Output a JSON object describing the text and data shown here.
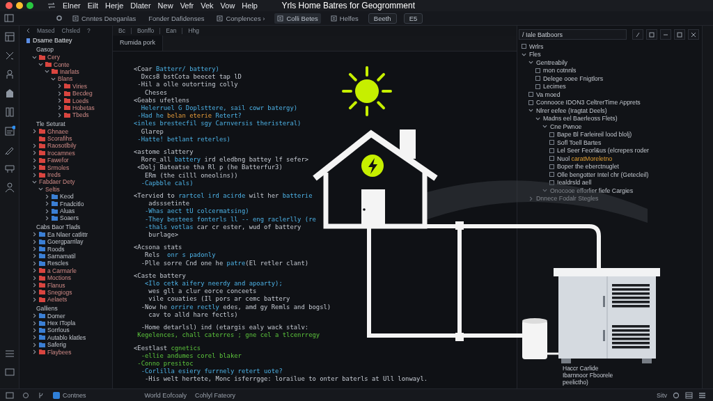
{
  "window": {
    "title": "Yrls Home Batres for Geogromment"
  },
  "menu": [
    "Elner",
    "Eilt",
    "Herje",
    "Dlater",
    "New",
    "Vefr",
    "Vek",
    "Vow",
    "Help"
  ],
  "toolbar": [
    {
      "label": "Cnntes Deeganlas",
      "kind": "icon",
      "selected": false
    },
    {
      "label": "Fonder Dafidenses",
      "kind": "text",
      "selected": false
    },
    {
      "label": "Conplences ›",
      "kind": "icon",
      "selected": false
    },
    {
      "label": "Colli Betes",
      "kind": "icon",
      "selected": true
    },
    {
      "label": "Helfes",
      "kind": "icon",
      "selected": false
    },
    {
      "label": "Beeth",
      "kind": "button",
      "selected": false
    },
    {
      "label": "E5",
      "kind": "button",
      "selected": false
    }
  ],
  "sidebar": {
    "toolbar": [
      "Mased",
      "Chsled",
      "?"
    ],
    "title": "Dsame Battey",
    "sections": [
      {
        "title": "Gasop",
        "items": [
          {
            "label": "Cery",
            "color": "#d9453f",
            "expanded": true,
            "children": [
              {
                "label": "Conte",
                "color": "#d9453f",
                "expanded": true,
                "children": [
                  {
                    "label": "Inarlats",
                    "color": "#d9453f",
                    "expanded": true,
                    "children": [
                      {
                        "label": "Blans",
                        "expanded": true,
                        "children": [
                          {
                            "label": "Viries",
                            "color": "#d9453f",
                            "expanded": false
                          },
                          {
                            "label": "Becdeg",
                            "color": "#d9453f",
                            "expanded": false
                          },
                          {
                            "label": "Loeds",
                            "color": "#d9453f",
                            "expanded": false
                          },
                          {
                            "label": "Hobetas",
                            "color": "#d9453f",
                            "expanded": false
                          },
                          {
                            "label": "Tbeds",
                            "color": "#d9453f",
                            "expanded": false
                          }
                        ]
                      }
                    ]
                  }
                ]
              }
            ]
          }
        ]
      },
      {
        "title": "Tle Seturat",
        "items": [
          {
            "label": "Ghnaee",
            "color": "#d9453f",
            "expanded": false
          },
          {
            "label": "Scorafihs",
            "color": "#d9453f"
          },
          {
            "label": "Raosotlbily",
            "color": "#d9453f",
            "expanded": false
          },
          {
            "label": "Irocamnes",
            "color": "#d9453f",
            "expanded": false
          },
          {
            "label": "Fawefor",
            "color": "#d9453f",
            "expanded": false
          },
          {
            "label": "Srmoles",
            "color": "#d9453f",
            "expanded": false
          },
          {
            "label": "Ireds",
            "color": "#d9453f",
            "expanded": false
          },
          {
            "label": "Fabdaer Dety",
            "expanded": true,
            "children": [
              {
                "label": "Seltis",
                "expanded": true,
                "children": [
                  {
                    "label": "Keod",
                    "color": "#3b7fd4",
                    "expanded": false
                  },
                  {
                    "label": "Fnadcitlo",
                    "color": "#3b7fd4",
                    "expanded": false
                  },
                  {
                    "label": "Aluas",
                    "color": "#3b7fd4",
                    "expanded": false
                  },
                  {
                    "label": "Soaers",
                    "color": "#3b7fd4",
                    "expanded": false
                  }
                ]
              }
            ]
          }
        ]
      },
      {
        "title": "Cabs Baor Tlads",
        "items": [
          {
            "label": "Ea Nlaer catlittr",
            "color": "#3b7fd4",
            "expanded": false
          },
          {
            "label": "Goergparrilay",
            "color": "#3b7fd4",
            "expanded": false
          },
          {
            "label": "Roods",
            "color": "#3b7fd4",
            "expanded": false
          },
          {
            "label": "Sarnamatil",
            "color": "#3b7fd4",
            "expanded": false
          },
          {
            "label": "Rescles",
            "color": "#3b7fd4",
            "expanded": false
          },
          {
            "label": "a Carmarle",
            "color": "#d9453f",
            "expanded": false
          },
          {
            "label": "Moctions",
            "color": "#d9453f",
            "expanded": false
          },
          {
            "label": "Flanus",
            "color": "#d9453f",
            "expanded": false
          },
          {
            "label": "Snegiogs",
            "color": "#d9453f",
            "expanded": false
          },
          {
            "label": "Aelaets",
            "color": "#d9453f",
            "expanded": false
          }
        ]
      },
      {
        "title": "Galliens",
        "items": [
          {
            "label": "Domer",
            "color": "#3b7fd4",
            "expanded": false
          },
          {
            "label": "Hex ITopla",
            "color": "#3b7fd4",
            "expanded": false
          },
          {
            "label": "Sorrlous",
            "color": "#3b7fd4",
            "expanded": false
          },
          {
            "label": "Autablo klatles",
            "color": "#3b7fd4",
            "expanded": false
          },
          {
            "label": "Saferig",
            "color": "#3b7fd4",
            "expanded": false
          },
          {
            "label": "Flaybees",
            "color": "#d9453f",
            "expanded": false
          }
        ]
      }
    ]
  },
  "editor": {
    "toolbar": [
      "Bc",
      "Bonffo",
      "Ean",
      "Hhg"
    ],
    "tab": "Rumida pork",
    "blocks": [
      {
        "lines": [
          [
            {
              "text": "<Coar ",
              "kind": "plain"
            },
            {
              "text": "Batterr/ battery)",
              "kind": "name"
            }
          ],
          [
            {
              "text": "  Dxcs8 bstCota beecet tap lD",
              "kind": "plain"
            }
          ],
          [
            {
              "text": " -Hil a olle outorting colly",
              "kind": "plain"
            }
          ],
          [
            {
              "text": "   Cheses",
              "kind": "plain"
            }
          ],
          [
            {
              "text": "<Geabs ufetlens",
              "kind": "plain"
            }
          ],
          [
            {
              "text": "  Helerruel G Doplsttere, sail cowr batergy)",
              "kind": "name"
            }
          ],
          [
            {
              "text": " -Had he ",
              "kind": "name"
            },
            {
              "text": "belan eterie",
              "kind": "warn"
            },
            {
              "text": " Retert?",
              "kind": "name"
            }
          ],
          [
            {
              "text": "<inles brestecfil sgy Carnversis theristeral)",
              "kind": "name"
            }
          ],
          [
            {
              "text": "  Glarep",
              "kind": "plain"
            }
          ],
          [
            {
              "text": " -Hatte! betlant reterles)",
              "kind": "name"
            }
          ]
        ]
      },
      {
        "lines": [
          [
            {
              "text": "<astome slattery",
              "kind": "plain"
            }
          ],
          [
            {
              "text": "  Rore_all ",
              "kind": "plain"
            },
            {
              "text": "battery",
              "kind": "name"
            },
            {
              "text": " ird eledbng battey lf sefer>",
              "kind": "plain"
            }
          ],
          [
            {
              "text": " <Dolj Bateatse tha Rl p (he Batterfur3)",
              "kind": "plain"
            }
          ],
          [
            {
              "text": "   ERm (the cilll oneolins))",
              "kind": "plain"
            }
          ],
          [
            {
              "text": "  -Capbble cals)",
              "kind": "name"
            }
          ]
        ]
      },
      {
        "lines": [
          [
            {
              "text": "<Tervied to ",
              "kind": "plain"
            },
            {
              "text": "rartcel ird acirde",
              "kind": "name"
            },
            {
              "text": " wilt her ",
              "kind": "plain"
            },
            {
              "text": "batterie",
              "kind": "name"
            }
          ],
          [
            {
              "text": "    adsssetinte",
              "kind": "plain"
            }
          ],
          [
            {
              "text": "   -Whas aect tU colcermatsing)",
              "kind": "name"
            }
          ],
          [
            {
              "text": "   -They bestees fonterls ll -- eng raclerlly (re",
              "kind": "name"
            }
          ],
          [
            {
              "text": "   -thals votlas ",
              "kind": "name"
            },
            {
              "text": "car cr ester, wud of battery",
              "kind": "plain"
            }
          ],
          [
            {
              "text": "    burlage>",
              "kind": "plain"
            }
          ]
        ]
      },
      {
        "lines": [
          [
            {
              "text": "<Acsona stats",
              "kind": "plain"
            }
          ],
          [
            {
              "text": "   Rels  ",
              "kind": "plain"
            },
            {
              "text": "onr s padonly",
              "kind": "name"
            }
          ],
          [
            {
              "text": "  -Plle sorre Cnd one he ",
              "kind": "plain"
            },
            {
              "text": "patre",
              "kind": "name"
            },
            {
              "text": "(El retler clant)",
              "kind": "plain"
            }
          ]
        ]
      },
      {
        "lines": [
          [
            {
              "text": "<Caste battery",
              "kind": "plain"
            }
          ],
          [
            {
              "text": "   <Ilo cetk aifery neerdy and apoarty);",
              "kind": "name"
            }
          ],
          [
            {
              "text": "    wes gll a clur eorce conceets",
              "kind": "plain"
            }
          ],
          [
            {
              "text": "    vile couaties (Il pors ar cemc battery",
              "kind": "plain"
            }
          ],
          [
            {
              "text": "  -Now he ",
              "kind": "plain"
            },
            {
              "text": "orrire rectly",
              "kind": "name"
            },
            {
              "text": " edes, amd gy Remls and bogsl)",
              "kind": "plain"
            }
          ],
          [
            {
              "text": "    cav to alld hare fectls)",
              "kind": "plain"
            }
          ]
        ]
      },
      {
        "lines": [
          [
            {
              "text": "  -Home detarlsl) ind (etargis ealy wack stalv:",
              "kind": "plain"
            }
          ],
          [
            {
              "text": " Kegelences, chall caterres ; gne cel a tlcenrregy",
              "kind": "ok"
            }
          ]
        ]
      },
      {
        "lines": [
          [
            {
              "text": "<Eestlast ",
              "kind": "plain"
            },
            {
              "text": "cgnetics",
              "kind": "ok"
            }
          ],
          [
            {
              "text": "  -ellie andumes corel blaker",
              "kind": "ok"
            }
          ],
          [
            {
              "text": " -Conno presitoc",
              "kind": "ok"
            }
          ],
          [
            {
              "text": "  -Corlilla esiery furrnely retert uote?",
              "kind": "name"
            }
          ],
          [
            {
              "text": "   -His welt hertete, Monc isferrgge: lorailue to onter baterls at Ull lonwayl.",
              "kind": "plain"
            }
          ]
        ]
      }
    ]
  },
  "panel": {
    "field": "/ Iale Batboors",
    "items": [
      {
        "label": "Wrlrs"
      },
      {
        "label": "Fles",
        "expanded": true,
        "children": [
          {
            "label": "Gentreabily",
            "expanded": true,
            "children": [
              {
                "label": "mon cotnnls"
              },
              {
                "label": "Delege ooee Fnigtlors"
              },
              {
                "label": "Lecimes"
              }
            ]
          },
          {
            "label": "Va moed"
          },
          {
            "label": "Connooce IDON3 CeltrerTime Apprets"
          },
          {
            "label": "Nlrer eefee (Iragtat Deels)",
            "expanded": true,
            "children": [
              {
                "label": "Madns eel Baerleoss Flets)",
                "expanded": true,
                "children": [
                  {
                    "label": "Cne Pwnoe",
                    "expanded": true,
                    "children": [
                      {
                        "label": "Bape Bl Farleireil lood blolj)"
                      },
                      {
                        "label": "Sofl Toell Bartes"
                      },
                      {
                        "label": "Lel Seer Feorl&us (elcrepes roder"
                      },
                      {
                        "label": "Nuol",
                        "highlight": "caratMoreletno"
                      },
                      {
                        "label": "Boper the eberctnuglet"
                      },
                      {
                        "label": "Olle bengotter Intel chr (Getecleil)"
                      },
                      {
                        "label": "Iealdrsld aell"
                      }
                    ]
                  },
                  {
                    "label": "Onocooe efforlier fiefe Cargies",
                    "expanded": true
                  }
                ]
              }
            ]
          },
          {
            "label": "Dnnece Fodalr Stegles",
            "expanded": false
          }
        ]
      }
    ],
    "caption": [
      "Haccr Carlide",
      "Ibarnnoor Fboorele",
      "peelictho)"
    ]
  },
  "status": {
    "items": [
      "Contnes",
      "World Eofcoaly",
      "Cohlyl Fateory"
    ],
    "right": "Sitv"
  }
}
